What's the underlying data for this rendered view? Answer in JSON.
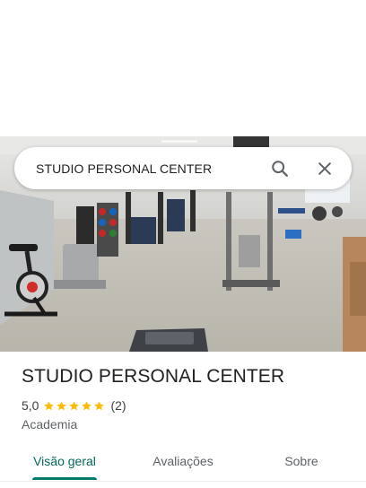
{
  "search": {
    "query": "STUDIO PERSONAL CENTER"
  },
  "icons": {
    "search": "search-icon",
    "close": "close-icon",
    "star": "star-icon"
  },
  "place": {
    "name": "STUDIO PERSONAL CENTER",
    "rating": "5,0",
    "stars": 5,
    "review_count": "(2)",
    "category": "Academia"
  },
  "tabs": [
    {
      "label": "Visão geral",
      "active": true
    },
    {
      "label": "Avaliações",
      "active": false
    },
    {
      "label": "Sobre",
      "active": false
    }
  ],
  "colors": {
    "star": "#fbbc04",
    "accent": "#00796b"
  }
}
